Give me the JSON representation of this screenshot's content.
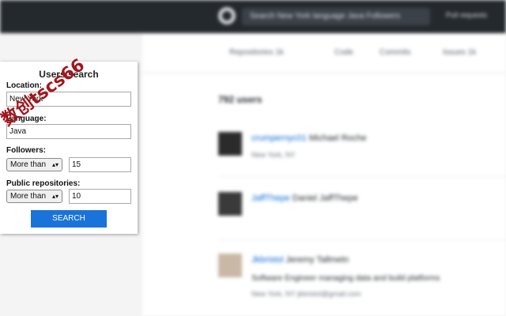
{
  "background": {
    "topbar": {
      "search_text": "Search New York language Java Followers",
      "right_text": "Pull requests"
    },
    "tabs": [
      {
        "label": "Repositories  1k"
      },
      {
        "label": "Code"
      },
      {
        "label": "Commits"
      },
      {
        "label": "Issues  1k"
      }
    ],
    "results_count": "792 users",
    "users": [
      {
        "login": "crumpernyc01",
        "name": "Michael Roche",
        "bio": "",
        "meta": "New York, NY"
      },
      {
        "login": "JaffThepe",
        "name": "Daniel JaffThepe",
        "bio": "",
        "meta": ""
      },
      {
        "login": "Jkbristol",
        "name": "Jeremy Tallmetn",
        "bio": "Software Engineer managing data and build platforms",
        "meta": "New York, NY    jkbristol@gmail.com"
      }
    ]
  },
  "popup": {
    "title": "Users search",
    "location_label": "Location:",
    "location_value": "New York",
    "language_label": "Language:",
    "language_value": "Java",
    "followers_label": "Followers:",
    "followers_op": "More than",
    "followers_value": "15",
    "repos_label": "Public repositories:",
    "repos_op": "More than",
    "repos_value": "10",
    "search_button": "SEARCH"
  },
  "watermark": "数创tscs66",
  "colors": {
    "topbar": "#24292e",
    "link": "#0366d6",
    "button": "#1a73d9",
    "watermark": "#a3161d"
  }
}
